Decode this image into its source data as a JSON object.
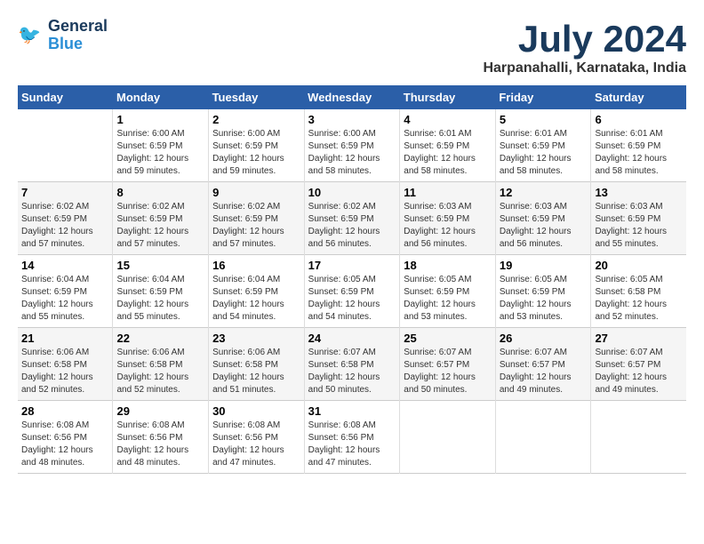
{
  "header": {
    "logo_line1": "General",
    "logo_line2": "Blue",
    "title": "July 2024",
    "subtitle": "Harpanahalli, Karnataka, India"
  },
  "days_of_week": [
    "Sunday",
    "Monday",
    "Tuesday",
    "Wednesday",
    "Thursday",
    "Friday",
    "Saturday"
  ],
  "weeks": [
    [
      {
        "num": "",
        "info": ""
      },
      {
        "num": "1",
        "info": "Sunrise: 6:00 AM\nSunset: 6:59 PM\nDaylight: 12 hours\nand 59 minutes."
      },
      {
        "num": "2",
        "info": "Sunrise: 6:00 AM\nSunset: 6:59 PM\nDaylight: 12 hours\nand 59 minutes."
      },
      {
        "num": "3",
        "info": "Sunrise: 6:00 AM\nSunset: 6:59 PM\nDaylight: 12 hours\nand 58 minutes."
      },
      {
        "num": "4",
        "info": "Sunrise: 6:01 AM\nSunset: 6:59 PM\nDaylight: 12 hours\nand 58 minutes."
      },
      {
        "num": "5",
        "info": "Sunrise: 6:01 AM\nSunset: 6:59 PM\nDaylight: 12 hours\nand 58 minutes."
      },
      {
        "num": "6",
        "info": "Sunrise: 6:01 AM\nSunset: 6:59 PM\nDaylight: 12 hours\nand 58 minutes."
      }
    ],
    [
      {
        "num": "7",
        "info": "Sunrise: 6:02 AM\nSunset: 6:59 PM\nDaylight: 12 hours\nand 57 minutes."
      },
      {
        "num": "8",
        "info": "Sunrise: 6:02 AM\nSunset: 6:59 PM\nDaylight: 12 hours\nand 57 minutes."
      },
      {
        "num": "9",
        "info": "Sunrise: 6:02 AM\nSunset: 6:59 PM\nDaylight: 12 hours\nand 57 minutes."
      },
      {
        "num": "10",
        "info": "Sunrise: 6:02 AM\nSunset: 6:59 PM\nDaylight: 12 hours\nand 56 minutes."
      },
      {
        "num": "11",
        "info": "Sunrise: 6:03 AM\nSunset: 6:59 PM\nDaylight: 12 hours\nand 56 minutes."
      },
      {
        "num": "12",
        "info": "Sunrise: 6:03 AM\nSunset: 6:59 PM\nDaylight: 12 hours\nand 56 minutes."
      },
      {
        "num": "13",
        "info": "Sunrise: 6:03 AM\nSunset: 6:59 PM\nDaylight: 12 hours\nand 55 minutes."
      }
    ],
    [
      {
        "num": "14",
        "info": "Sunrise: 6:04 AM\nSunset: 6:59 PM\nDaylight: 12 hours\nand 55 minutes."
      },
      {
        "num": "15",
        "info": "Sunrise: 6:04 AM\nSunset: 6:59 PM\nDaylight: 12 hours\nand 55 minutes."
      },
      {
        "num": "16",
        "info": "Sunrise: 6:04 AM\nSunset: 6:59 PM\nDaylight: 12 hours\nand 54 minutes."
      },
      {
        "num": "17",
        "info": "Sunrise: 6:05 AM\nSunset: 6:59 PM\nDaylight: 12 hours\nand 54 minutes."
      },
      {
        "num": "18",
        "info": "Sunrise: 6:05 AM\nSunset: 6:59 PM\nDaylight: 12 hours\nand 53 minutes."
      },
      {
        "num": "19",
        "info": "Sunrise: 6:05 AM\nSunset: 6:59 PM\nDaylight: 12 hours\nand 53 minutes."
      },
      {
        "num": "20",
        "info": "Sunrise: 6:05 AM\nSunset: 6:58 PM\nDaylight: 12 hours\nand 52 minutes."
      }
    ],
    [
      {
        "num": "21",
        "info": "Sunrise: 6:06 AM\nSunset: 6:58 PM\nDaylight: 12 hours\nand 52 minutes."
      },
      {
        "num": "22",
        "info": "Sunrise: 6:06 AM\nSunset: 6:58 PM\nDaylight: 12 hours\nand 52 minutes."
      },
      {
        "num": "23",
        "info": "Sunrise: 6:06 AM\nSunset: 6:58 PM\nDaylight: 12 hours\nand 51 minutes."
      },
      {
        "num": "24",
        "info": "Sunrise: 6:07 AM\nSunset: 6:58 PM\nDaylight: 12 hours\nand 50 minutes."
      },
      {
        "num": "25",
        "info": "Sunrise: 6:07 AM\nSunset: 6:57 PM\nDaylight: 12 hours\nand 50 minutes."
      },
      {
        "num": "26",
        "info": "Sunrise: 6:07 AM\nSunset: 6:57 PM\nDaylight: 12 hours\nand 49 minutes."
      },
      {
        "num": "27",
        "info": "Sunrise: 6:07 AM\nSunset: 6:57 PM\nDaylight: 12 hours\nand 49 minutes."
      }
    ],
    [
      {
        "num": "28",
        "info": "Sunrise: 6:08 AM\nSunset: 6:56 PM\nDaylight: 12 hours\nand 48 minutes."
      },
      {
        "num": "29",
        "info": "Sunrise: 6:08 AM\nSunset: 6:56 PM\nDaylight: 12 hours\nand 48 minutes."
      },
      {
        "num": "30",
        "info": "Sunrise: 6:08 AM\nSunset: 6:56 PM\nDaylight: 12 hours\nand 47 minutes."
      },
      {
        "num": "31",
        "info": "Sunrise: 6:08 AM\nSunset: 6:56 PM\nDaylight: 12 hours\nand 47 minutes."
      },
      {
        "num": "",
        "info": ""
      },
      {
        "num": "",
        "info": ""
      },
      {
        "num": "",
        "info": ""
      }
    ]
  ]
}
